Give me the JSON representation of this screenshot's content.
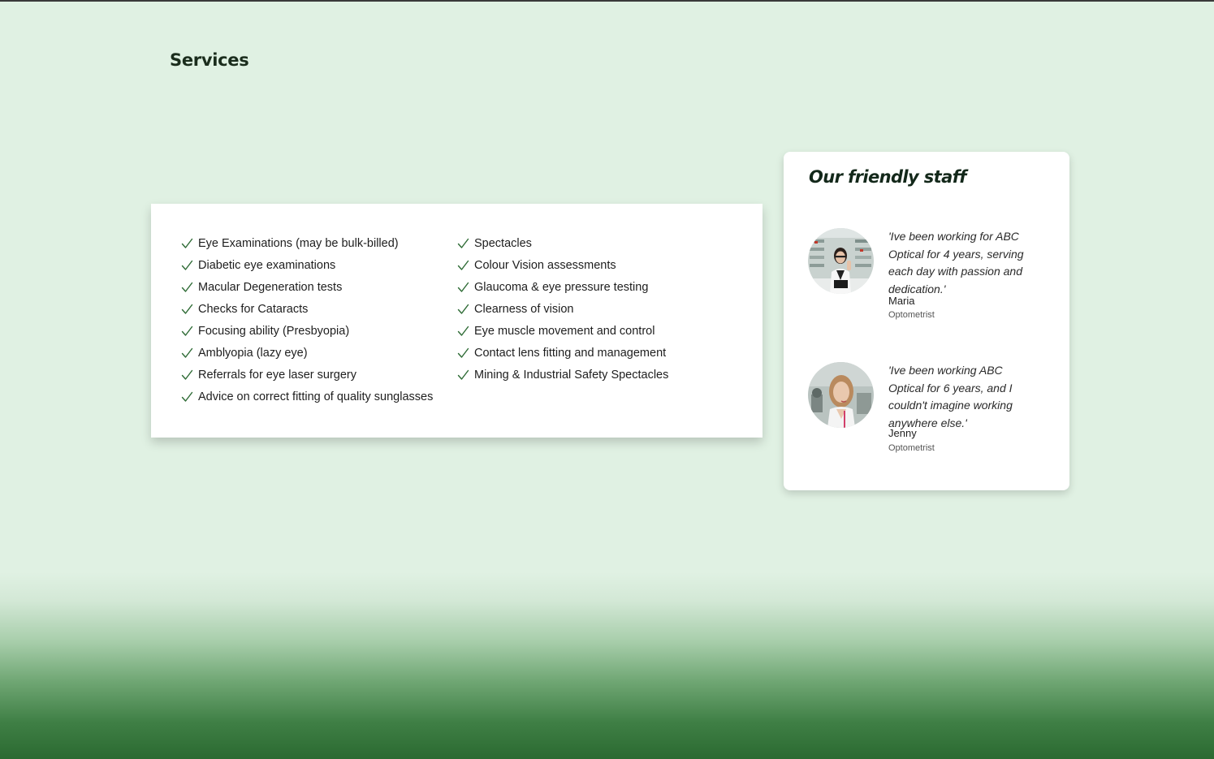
{
  "page": {
    "title": "Services"
  },
  "services": {
    "column_1": [
      "Eye Examinations (may be bulk-billed)",
      "Diabetic eye examinations",
      "Macular Degeneration tests",
      "Checks for Cataracts",
      "Focusing ability (Presbyopia)",
      "Amblyopia (lazy eye)",
      "Referrals for eye laser surgery",
      "Advice on correct fitting of quality sunglasses"
    ],
    "column_2": [
      "Spectacles",
      "Colour Vision assessments",
      "Glaucoma & eye pressure testing",
      "Clearness of vision",
      "Eye muscle movement and control",
      "Contact lens fitting and management",
      "Mining & Industrial Safety Spectacles"
    ],
    "item_icon": "check-icon"
  },
  "staff": {
    "heading": "Our friendly staff",
    "members": [
      {
        "quote": "'Ive been working for ABC Optical for 4 years, serving each day with passion and dedication.'",
        "name": "Maria",
        "role": "Optometrist"
      },
      {
        "quote": "'Ive been working ABC Optical for 6 years, and I couldn't imagine working anywhere else.'",
        "name": "Jenny",
        "role": "Optometrist"
      }
    ]
  },
  "colors": {
    "accent_green": "#2b6a31",
    "page_background": "#e0f1e3",
    "check_color": "#2e6b35"
  }
}
